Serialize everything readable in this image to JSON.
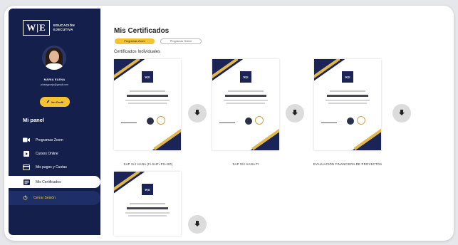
{
  "brand": {
    "logo_text": "W|E",
    "line1": "EDUCACIÓN",
    "line2": "EJECUTIVA"
  },
  "user": {
    "name": "MARIA ELENA",
    "email": "pilotayqueja@gmail.com",
    "profile_button": "Ver Perfil"
  },
  "sidebar": {
    "panel_title": "Mi panel",
    "items": [
      {
        "label": "Programas Zoom",
        "icon": "video-camera-icon"
      },
      {
        "label": "Cursos Online",
        "icon": "play-icon"
      },
      {
        "label": "Mis pagos y Cuotas",
        "icon": "card-icon"
      },
      {
        "label": "Mis Certificados",
        "icon": "certificate-icon",
        "active": true
      }
    ],
    "logout": "Cerrar Sesión"
  },
  "main": {
    "title": "Mis Certificados",
    "tabs": [
      {
        "label": "Programas Zoom",
        "active": true
      },
      {
        "label": "Programas Online",
        "active": false
      }
    ],
    "section_label": "Certificados Individuales",
    "certificates": [
      {
        "caption": "SAP S/4 HANA (Fi-SHFi-PS+SD)",
        "body_title": "SAP S/4 HANA (Fi-SHFi-PS+SD)"
      },
      {
        "caption": "SAP S/4 HANA FI",
        "body_title": "SAP S/4 HANA FI"
      },
      {
        "caption": "EVALUACIÓN FINANCIERA DE PROYECTOS",
        "body_title": "Evaluación Financiera de Proyectos"
      },
      {
        "caption": "",
        "body_title": "NPL Logística con Power BI"
      }
    ]
  },
  "colors": {
    "sidebar_bg": "#14204b",
    "accent": "#f5c232",
    "cert_blue": "#1a2457",
    "cert_gold": "#e2b84a"
  }
}
